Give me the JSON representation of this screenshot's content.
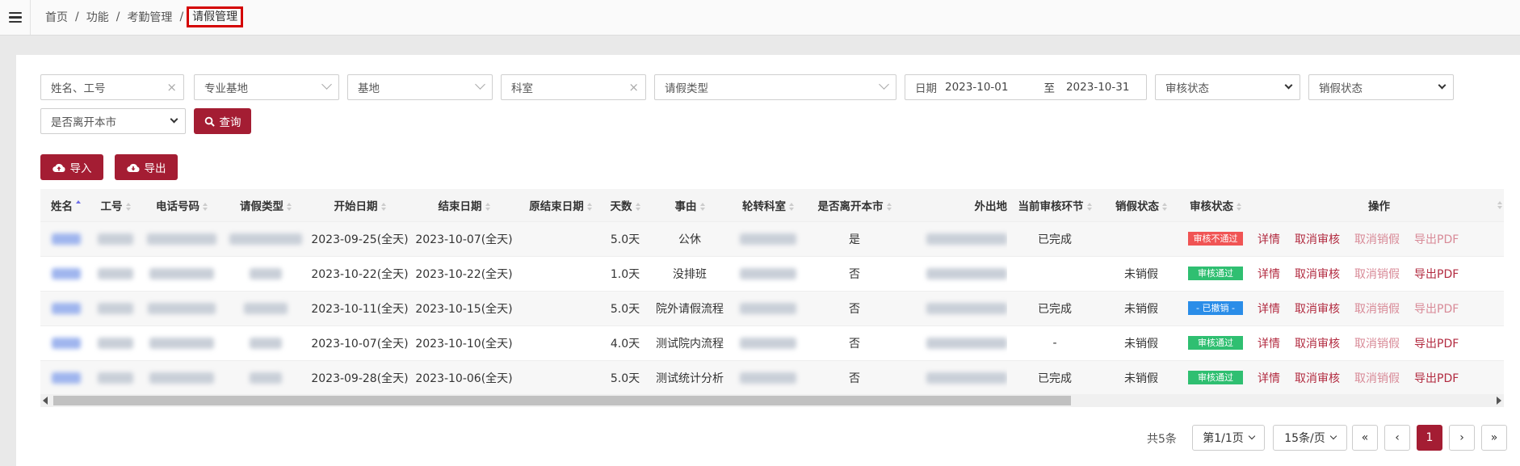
{
  "breadcrumb": {
    "items": [
      "首页",
      "功能",
      "考勤管理"
    ],
    "current": "请假管理"
  },
  "filters": {
    "name_placeholder": "姓名、工号",
    "specialty_base": "专业基地",
    "base": "基地",
    "department": "科室",
    "leave_type": "请假类型",
    "date_label": "日期",
    "date_from": "2023-10-01",
    "date_to_label": "至",
    "date_to": "2023-10-31",
    "audit_status": "审核状态",
    "cancel_status": "销假状态",
    "leave_city": "是否离开本市",
    "query": "查询",
    "clear": "×"
  },
  "toolbar": {
    "import": "导入",
    "export": "导出"
  },
  "table": {
    "headers": {
      "name": "姓名",
      "id": "工号",
      "phone": "电话号码",
      "type": "请假类型",
      "start": "开始日期",
      "end": "结束日期",
      "orig_end": "原结束日期",
      "days": "天数",
      "reason": "事由",
      "dept": "轮转科室",
      "leave_city": "是否离开本市",
      "out": "外出地",
      "node": "当前审核环节",
      "cancel": "销假状态",
      "audit": "审核状态",
      "ops": "操作"
    },
    "rows": [
      {
        "start": "2023-09-25(全天)",
        "end": "2023-10-07(全天)",
        "days": "5.0天",
        "reason": "公休",
        "leave_city": "是",
        "node": "已完成",
        "cancel": "",
        "audit": "审核不通过",
        "audit_kind": "fail",
        "cancel_dim": true,
        "pdf_dim": true
      },
      {
        "start": "2023-10-22(全天)",
        "end": "2023-10-22(全天)",
        "days": "1.0天",
        "reason": "没排班",
        "leave_city": "否",
        "node": "",
        "cancel": "未销假",
        "audit": "审核通过",
        "audit_kind": "pass",
        "cancel_dim": true,
        "pdf_dim": false
      },
      {
        "start": "2023-10-11(全天)",
        "end": "2023-10-15(全天)",
        "days": "5.0天",
        "reason": "院外请假流程",
        "leave_city": "否",
        "node": "已完成",
        "cancel": "未销假",
        "audit": "- 已撤销 -",
        "audit_kind": "revoked",
        "cancel_dim": true,
        "pdf_dim": true
      },
      {
        "start": "2023-10-07(全天)",
        "end": "2023-10-10(全天)",
        "days": "4.0天",
        "reason": "测试院内流程",
        "leave_city": "否",
        "node": "-",
        "cancel": "未销假",
        "audit": "审核通过",
        "audit_kind": "pass",
        "cancel_dim": true,
        "pdf_dim": false
      },
      {
        "start": "2023-09-28(全天)",
        "end": "2023-10-06(全天)",
        "days": "5.0天",
        "reason": "测试统计分析",
        "leave_city": "否",
        "node": "已完成",
        "cancel": "未销假",
        "audit": "审核通过",
        "audit_kind": "pass",
        "cancel_dim": true,
        "pdf_dim": false
      }
    ],
    "actions": {
      "detail": "详情",
      "cancel_audit": "取消审核",
      "cancel_leave": "取消销假",
      "export_pdf": "导出PDF"
    }
  },
  "pagination": {
    "total": "共5条",
    "page_info": "第1/1页",
    "page_size": "15条/页",
    "first": "«",
    "prev": "‹",
    "current": "1",
    "next": "›",
    "last": "»"
  },
  "colors": {
    "primary": "#a41d33",
    "fail": "#f05454",
    "pass": "#2fbf71",
    "revoked": "#2a8de8"
  }
}
